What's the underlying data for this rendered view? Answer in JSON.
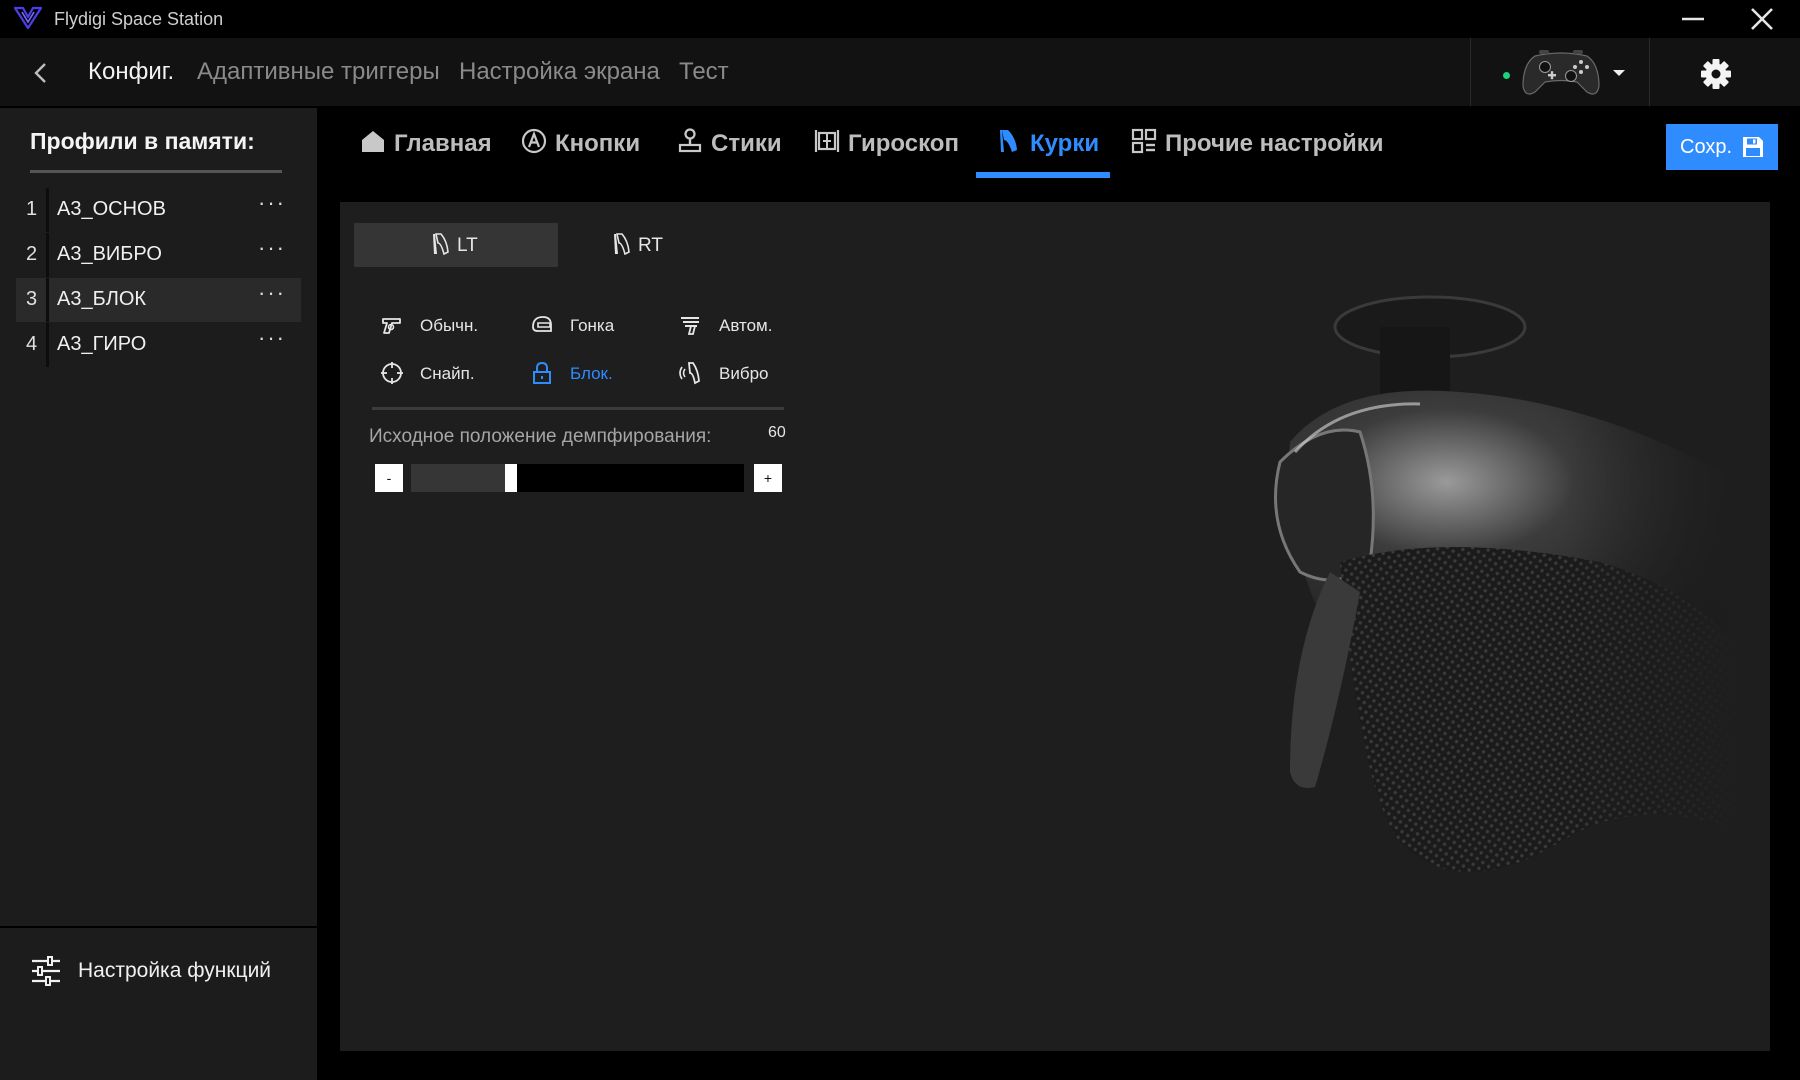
{
  "window": {
    "title": "Flydigi Space Station",
    "colors": {
      "accent": "#2f8cff",
      "logo": "#4c3ee8",
      "status_connected": "#1fd17a"
    }
  },
  "topnav": {
    "tabs": [
      {
        "label": "Конфиг.",
        "active": true
      },
      {
        "label": "Адаптивные триггеры",
        "active": false
      },
      {
        "label": "Настройка экрана",
        "active": false
      },
      {
        "label": "Тест",
        "active": false
      }
    ],
    "device": {
      "status_icon": "connected-dot",
      "image": "controller-icon",
      "caret": "chevron-down-icon"
    },
    "settings_icon": "gear-icon"
  },
  "sidebar": {
    "title": "Профили в памяти:",
    "profiles": [
      {
        "num": "1",
        "name": "A3_ОСНОВ",
        "more": "···",
        "active": false
      },
      {
        "num": "2",
        "name": "A3_ВИБРО",
        "more": "···",
        "active": false
      },
      {
        "num": "3",
        "name": "A3_БЛОК",
        "more": "···",
        "active": true
      },
      {
        "num": "4",
        "name": "A3_ГИРО",
        "more": "···",
        "active": false
      }
    ],
    "func_settings": {
      "label": "Настройка функций",
      "icon": "sliders-icon"
    }
  },
  "categories": [
    {
      "label": "Главная",
      "icon": "home-icon",
      "active": false
    },
    {
      "label": "Кнопки",
      "icon": "button-a-icon",
      "active": false
    },
    {
      "label": "Стики",
      "icon": "joystick-icon",
      "active": false
    },
    {
      "label": "Гироскоп",
      "icon": "gyro-icon",
      "active": false
    },
    {
      "label": "Курки",
      "icon": "trigger-icon",
      "active": true
    },
    {
      "label": "Прочие настройки",
      "icon": "grid-icon",
      "active": false
    }
  ],
  "save": {
    "label": "Сохр.",
    "icon": "floppy-icon"
  },
  "triggers": {
    "tabs": [
      {
        "label": "LT",
        "active": true
      },
      {
        "label": "RT",
        "active": false
      }
    ],
    "modes": [
      {
        "label": "Обычн.",
        "icon": "gun-icon",
        "active": false
      },
      {
        "label": "Гонка",
        "icon": "helmet-icon",
        "active": false
      },
      {
        "label": "Автом.",
        "icon": "auto-fire-icon",
        "active": false
      },
      {
        "label": "Снайп.",
        "icon": "crosshair-icon",
        "active": false
      },
      {
        "label": "Блок.",
        "icon": "lock-icon",
        "active": true
      },
      {
        "label": "Вибро",
        "icon": "vibration-icon",
        "active": false
      }
    ],
    "damping": {
      "label": "Исходное положение демпфирования:",
      "value": "60",
      "fraction": 0.3,
      "minus": "-",
      "plus": "+"
    }
  }
}
